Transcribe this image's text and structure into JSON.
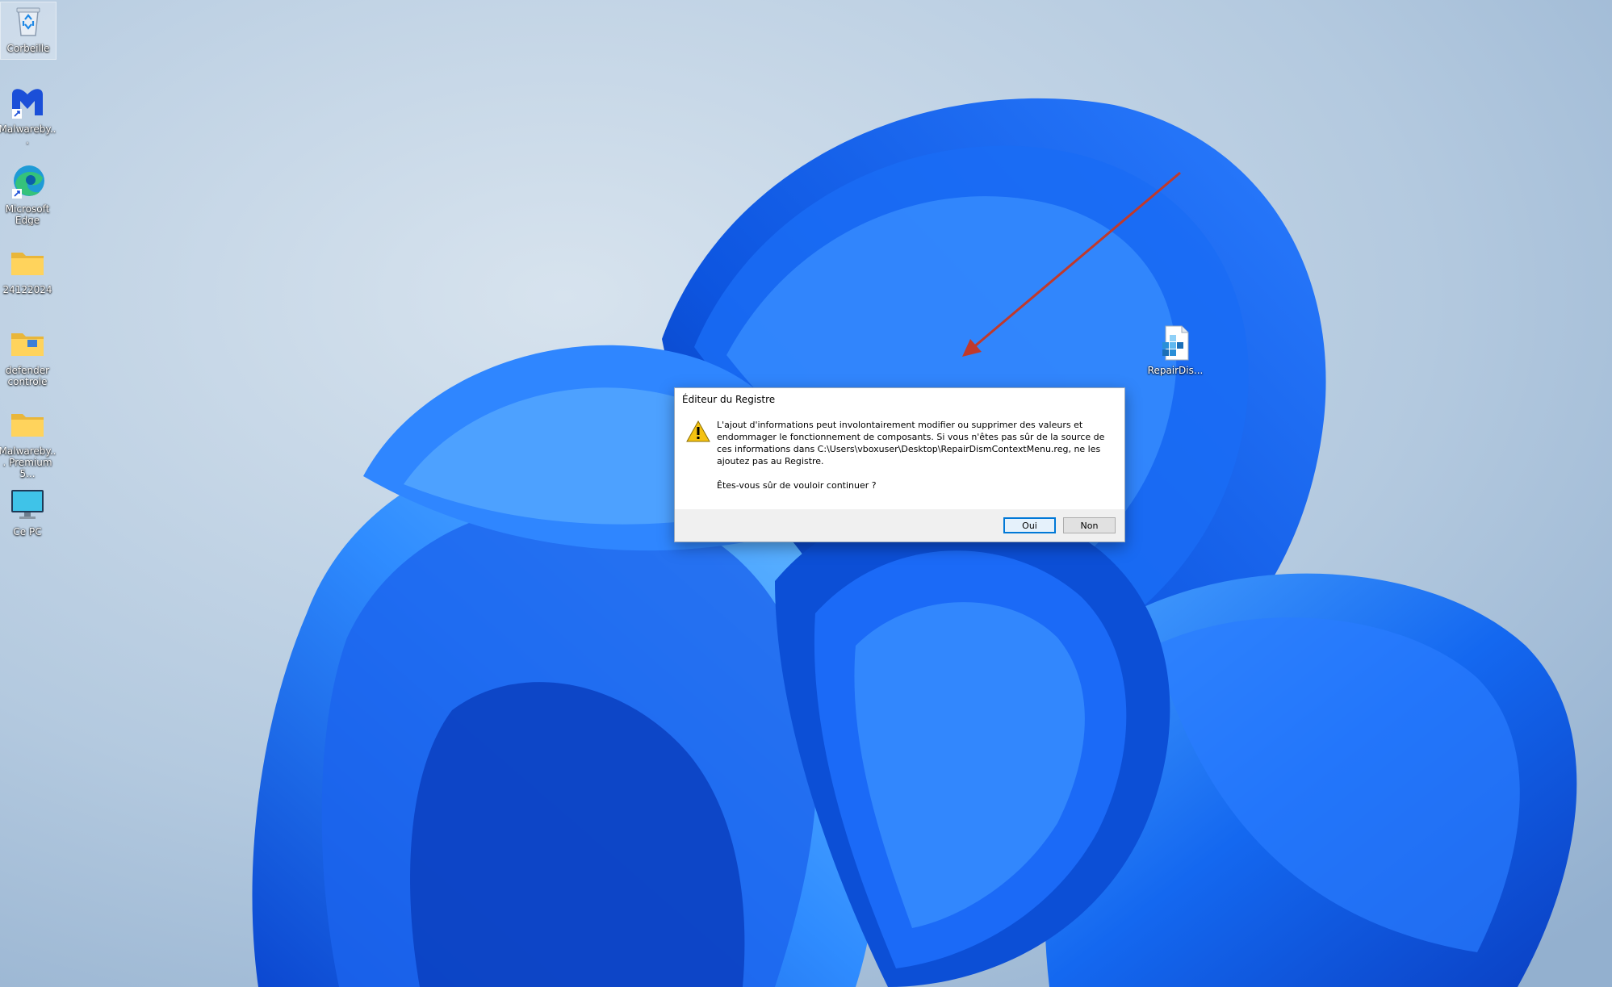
{
  "desktop": {
    "icons": [
      {
        "label": "Corbeille",
        "icon": "recycle-bin-icon"
      },
      {
        "label": "Malwareby...",
        "icon": "malwarebytes-icon"
      },
      {
        "label": "Microsoft Edge",
        "icon": "edge-icon"
      },
      {
        "label": "24122024",
        "icon": "folder-icon"
      },
      {
        "label": "defender controle",
        "icon": "folder-icon"
      },
      {
        "label": "Malwareby... Premium 5...",
        "icon": "folder-icon"
      },
      {
        "label": "Ce PC",
        "icon": "computer-icon"
      },
      {
        "label": "RepairDis...",
        "icon": "registry-file-icon"
      }
    ]
  },
  "dialog": {
    "title": "Éditeur du Registre",
    "icon": "warning-icon",
    "message_1": "L'ajout d'informations peut involontairement modifier ou supprimer des valeurs et endommager le fonctionnement de composants. Si vous n'êtes pas sûr de la source de ces informations dans C:\\Users\\vboxuser\\Desktop\\RepairDismContextMenu.reg, ne les ajoutez pas au Registre.",
    "message_2": "Êtes-vous sûr de vouloir continuer ?",
    "yes_label": "Oui",
    "no_label": "Non"
  },
  "colors": {
    "accent": "#0078d7",
    "arrow": "#c0392b",
    "warning": "#f5c211"
  }
}
